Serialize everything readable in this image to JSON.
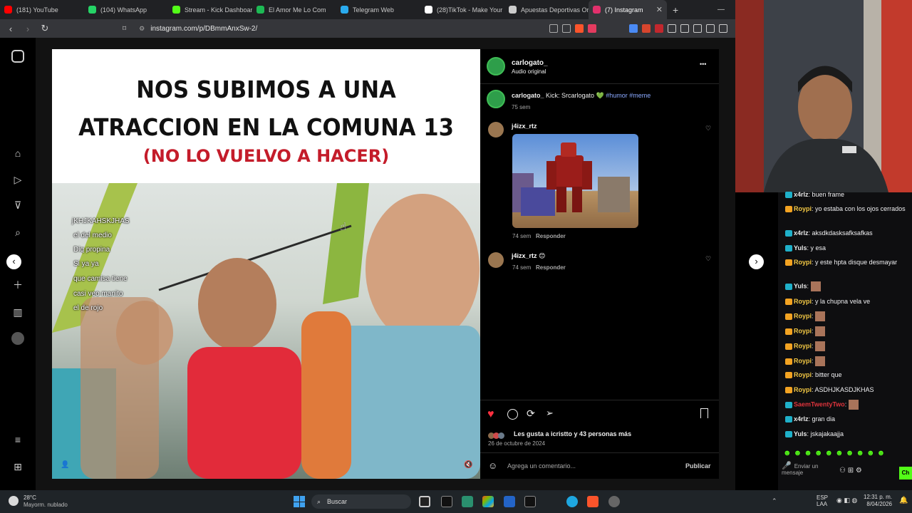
{
  "tabs": [
    {
      "title": "(181) YouTube",
      "color": "#ff0000"
    },
    {
      "title": "(104) WhatsApp",
      "color": "#25d366"
    },
    {
      "title": "Stream - Kick Dashboar",
      "color": "#53fc18"
    },
    {
      "title": "El Amor Me Lo Com",
      "color": "#1db954"
    },
    {
      "title": "Telegram Web",
      "color": "#2aabee"
    },
    {
      "title": "(28)TikTok - Make Your",
      "color": "#ffffff"
    },
    {
      "title": "Apuestas Deportivas Or",
      "color": "#cccccc"
    },
    {
      "title": "(7) Instagram",
      "color": "#e1306c",
      "close": "✕"
    }
  ],
  "new_tab": "+",
  "window_min": "—",
  "address": {
    "url": "instagram.com/p/DBmmAnxSw-2/"
  },
  "video": {
    "title_line1": "NOS SUBIMOS A UNA",
    "title_line2": "ATRACCION EN LA COMUNA 13",
    "subtitle": "(NO LO VUELVO A HACER)",
    "chat_overlay": [
      "jKHJKAHSKJHAS",
      "el del medio",
      "Diq propina",
      "Si ya ya",
      "que camisa tiene",
      "casi veo manito",
      "el de rojo"
    ]
  },
  "post": {
    "author": "carlogato_",
    "audio": "Audio original",
    "more": "•••",
    "caption_user": "carlogato_",
    "caption_text": "Kick: Srcarlogato 💚",
    "caption_tags": "#humor #meme",
    "caption_time": "75 sem",
    "comments": [
      {
        "user": "j4izx_rtz",
        "text": "",
        "time": "74 sem",
        "reply": "Responder",
        "gif": true
      },
      {
        "user": "j4izx_rtz",
        "text": "😊",
        "time": "74 sem",
        "reply": "Responder"
      }
    ],
    "likes_text": "Les gusta a icristto y 43 personas más",
    "date": "26 de octubre de 2024",
    "comment_placeholder": "Agrega un comentario...",
    "publish": "Publicar"
  },
  "stream_chat": [
    {
      "user": "x4rlz",
      "text": "buen frame",
      "color": "#e8e8e8"
    },
    {
      "user": "Roypi",
      "text": "yo estaba con los ojos cerrados",
      "color": "#f3c844"
    },
    {
      "user": "x4rlz",
      "text": "aksdkdasksafksafkas",
      "color": "#e8e8e8"
    },
    {
      "user": "Yuls",
      "text": "y esa",
      "color": "#e8e8e8"
    },
    {
      "user": "Roypi",
      "text": "y este hpta disque desmayar",
      "color": "#f3c844"
    },
    {
      "user": "Yuls",
      "text": "",
      "color": "#e8e8e8"
    },
    {
      "user": "Roypi",
      "text": "y la chupna vela ve",
      "color": "#f3c844"
    },
    {
      "user": "Roypi",
      "text": "",
      "color": "#f3c844"
    },
    {
      "user": "Roypi",
      "text": "",
      "color": "#f3c844"
    },
    {
      "user": "Roypi",
      "text": "",
      "color": "#f3c844"
    },
    {
      "user": "Roypi",
      "text": "",
      "color": "#f3c844"
    },
    {
      "user": "Roypi",
      "text": "bitter que",
      "color": "#f3c844"
    },
    {
      "user": "Roypi",
      "text": "ASDHJKASDJKHAS",
      "color": "#f3c844"
    },
    {
      "user": "SaemTwentyTwo",
      "text": "",
      "color": "#e0343c"
    },
    {
      "user": "x4rlz",
      "text": "gran dia",
      "color": "#e8e8e8"
    },
    {
      "user": "Yuls",
      "text": "jskajakaajja",
      "color": "#e8e8e8"
    }
  ],
  "chat_input": {
    "placeholder": "Enviar un mensaje",
    "chat_btn": "Ch"
  },
  "taskbar": {
    "weather_temp": "28°C",
    "weather_desc": "Mayorm. nublado",
    "search": "Buscar",
    "lang1": "ESP",
    "lang2": "LAA",
    "time": "12:31 p. m.",
    "date": "8/04/2026"
  }
}
